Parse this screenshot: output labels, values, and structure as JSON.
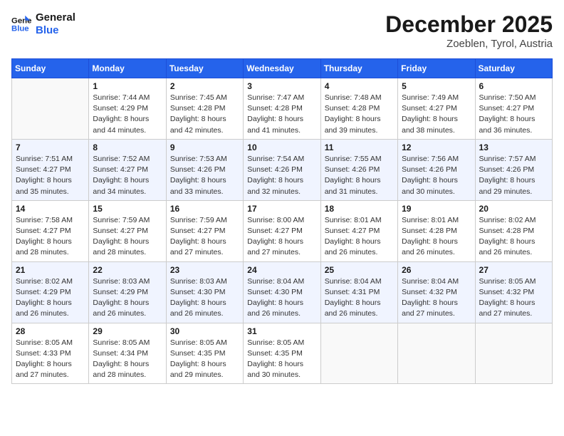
{
  "header": {
    "logo_line1": "General",
    "logo_line2": "Blue",
    "month_year": "December 2025",
    "location": "Zoeblen, Tyrol, Austria"
  },
  "days_of_week": [
    "Sunday",
    "Monday",
    "Tuesday",
    "Wednesday",
    "Thursday",
    "Friday",
    "Saturday"
  ],
  "weeks": [
    [
      {
        "day": "",
        "empty": true
      },
      {
        "day": "1",
        "sunrise": "7:44 AM",
        "sunset": "4:29 PM",
        "daylight": "8 hours and 44 minutes."
      },
      {
        "day": "2",
        "sunrise": "7:45 AM",
        "sunset": "4:28 PM",
        "daylight": "8 hours and 42 minutes."
      },
      {
        "day": "3",
        "sunrise": "7:47 AM",
        "sunset": "4:28 PM",
        "daylight": "8 hours and 41 minutes."
      },
      {
        "day": "4",
        "sunrise": "7:48 AM",
        "sunset": "4:28 PM",
        "daylight": "8 hours and 39 minutes."
      },
      {
        "day": "5",
        "sunrise": "7:49 AM",
        "sunset": "4:27 PM",
        "daylight": "8 hours and 38 minutes."
      },
      {
        "day": "6",
        "sunrise": "7:50 AM",
        "sunset": "4:27 PM",
        "daylight": "8 hours and 36 minutes."
      }
    ],
    [
      {
        "day": "7",
        "sunrise": "7:51 AM",
        "sunset": "4:27 PM",
        "daylight": "8 hours and 35 minutes."
      },
      {
        "day": "8",
        "sunrise": "7:52 AM",
        "sunset": "4:27 PM",
        "daylight": "8 hours and 34 minutes."
      },
      {
        "day": "9",
        "sunrise": "7:53 AM",
        "sunset": "4:26 PM",
        "daylight": "8 hours and 33 minutes."
      },
      {
        "day": "10",
        "sunrise": "7:54 AM",
        "sunset": "4:26 PM",
        "daylight": "8 hours and 32 minutes."
      },
      {
        "day": "11",
        "sunrise": "7:55 AM",
        "sunset": "4:26 PM",
        "daylight": "8 hours and 31 minutes."
      },
      {
        "day": "12",
        "sunrise": "7:56 AM",
        "sunset": "4:26 PM",
        "daylight": "8 hours and 30 minutes."
      },
      {
        "day": "13",
        "sunrise": "7:57 AM",
        "sunset": "4:26 PM",
        "daylight": "8 hours and 29 minutes."
      }
    ],
    [
      {
        "day": "14",
        "sunrise": "7:58 AM",
        "sunset": "4:27 PM",
        "daylight": "8 hours and 28 minutes."
      },
      {
        "day": "15",
        "sunrise": "7:59 AM",
        "sunset": "4:27 PM",
        "daylight": "8 hours and 28 minutes."
      },
      {
        "day": "16",
        "sunrise": "7:59 AM",
        "sunset": "4:27 PM",
        "daylight": "8 hours and 27 minutes."
      },
      {
        "day": "17",
        "sunrise": "8:00 AM",
        "sunset": "4:27 PM",
        "daylight": "8 hours and 27 minutes."
      },
      {
        "day": "18",
        "sunrise": "8:01 AM",
        "sunset": "4:27 PM",
        "daylight": "8 hours and 26 minutes."
      },
      {
        "day": "19",
        "sunrise": "8:01 AM",
        "sunset": "4:28 PM",
        "daylight": "8 hours and 26 minutes."
      },
      {
        "day": "20",
        "sunrise": "8:02 AM",
        "sunset": "4:28 PM",
        "daylight": "8 hours and 26 minutes."
      }
    ],
    [
      {
        "day": "21",
        "sunrise": "8:02 AM",
        "sunset": "4:29 PM",
        "daylight": "8 hours and 26 minutes."
      },
      {
        "day": "22",
        "sunrise": "8:03 AM",
        "sunset": "4:29 PM",
        "daylight": "8 hours and 26 minutes."
      },
      {
        "day": "23",
        "sunrise": "8:03 AM",
        "sunset": "4:30 PM",
        "daylight": "8 hours and 26 minutes."
      },
      {
        "day": "24",
        "sunrise": "8:04 AM",
        "sunset": "4:30 PM",
        "daylight": "8 hours and 26 minutes."
      },
      {
        "day": "25",
        "sunrise": "8:04 AM",
        "sunset": "4:31 PM",
        "daylight": "8 hours and 26 minutes."
      },
      {
        "day": "26",
        "sunrise": "8:04 AM",
        "sunset": "4:32 PM",
        "daylight": "8 hours and 27 minutes."
      },
      {
        "day": "27",
        "sunrise": "8:05 AM",
        "sunset": "4:32 PM",
        "daylight": "8 hours and 27 minutes."
      }
    ],
    [
      {
        "day": "28",
        "sunrise": "8:05 AM",
        "sunset": "4:33 PM",
        "daylight": "8 hours and 27 minutes."
      },
      {
        "day": "29",
        "sunrise": "8:05 AM",
        "sunset": "4:34 PM",
        "daylight": "8 hours and 28 minutes."
      },
      {
        "day": "30",
        "sunrise": "8:05 AM",
        "sunset": "4:35 PM",
        "daylight": "8 hours and 29 minutes."
      },
      {
        "day": "31",
        "sunrise": "8:05 AM",
        "sunset": "4:35 PM",
        "daylight": "8 hours and 30 minutes."
      },
      {
        "day": "",
        "empty": true
      },
      {
        "day": "",
        "empty": true
      },
      {
        "day": "",
        "empty": true
      }
    ]
  ]
}
